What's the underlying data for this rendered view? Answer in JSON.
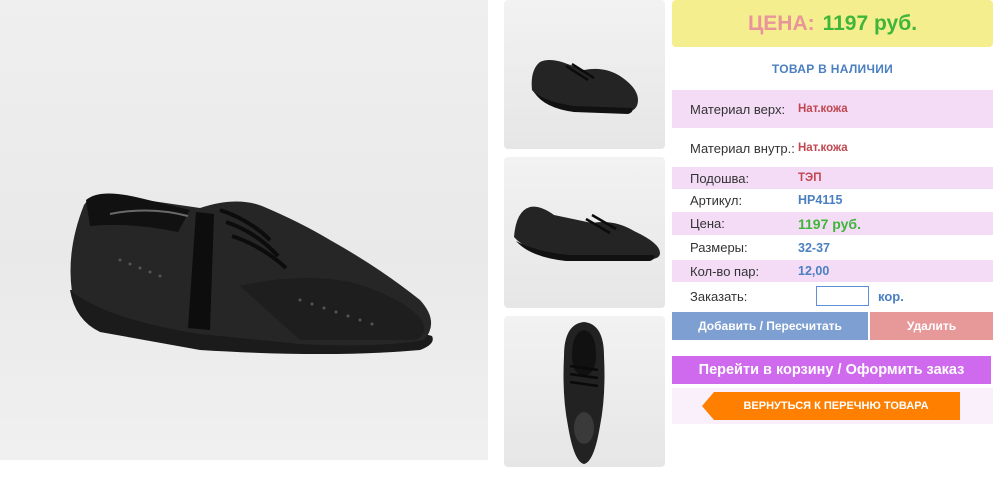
{
  "price": {
    "label": "ЦЕНА:",
    "value": "1197 руб."
  },
  "availability": "ТОВАР В НАЛИЧИИ",
  "specs": [
    {
      "label": "Материал верх:",
      "value": "Нат.кожа"
    },
    {
      "label": "Материал внутр.:",
      "value": "Нат.кожа"
    },
    {
      "label": "Подошва:",
      "value": "ТЭП"
    },
    {
      "label": "Артикул:",
      "value": "HP4115"
    },
    {
      "label": "Цена:",
      "value": "1197 руб."
    },
    {
      "label": "Размеры:",
      "value": "32-37"
    },
    {
      "label": "Кол-во пар:",
      "value": "12,00"
    }
  ],
  "order": {
    "label": "Заказать:",
    "quantity_value": "",
    "unit": "кор."
  },
  "buttons": {
    "add": "Добавить / Пересчитать",
    "delete": "Удалить",
    "cart": "Перейти в корзину / Оформить заказ",
    "back": "ВЕРНУТЬСЯ К ПЕРЕЧНЮ ТОВАРА"
  },
  "colors": {
    "price_bg": "#f5ee8f",
    "price_label": "#e8959a",
    "price_value": "#3fb53a",
    "row_pink": "#f4dcf7",
    "link_blue": "#4a7fc1",
    "value_red": "#c0474f",
    "add_button": "#7d9fd2",
    "delete_button": "#e79898",
    "cart_button": "#cf69ee",
    "back_button": "#ff7f00"
  }
}
